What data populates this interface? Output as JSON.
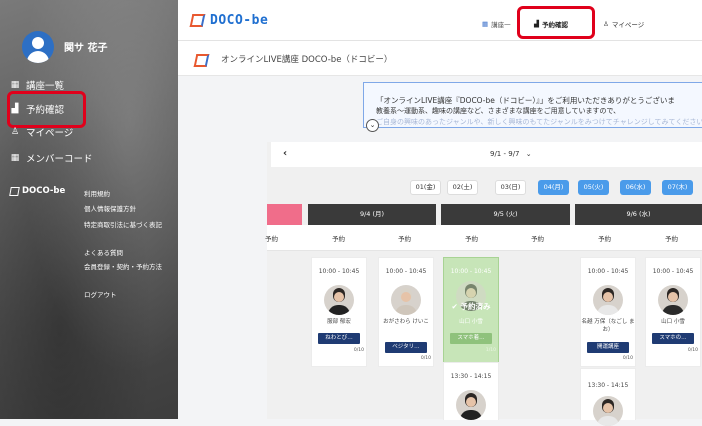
{
  "user": {
    "name": "関サ 花子"
  },
  "sidebar": {
    "items": [
      {
        "label": "講座一覧",
        "icon": "calendar-icon"
      },
      {
        "label": "予約確認",
        "icon": "booking-icon"
      },
      {
        "label": "マイページ",
        "icon": "person-icon"
      },
      {
        "label": "メンバーコード",
        "icon": "grid-icon"
      }
    ],
    "brand": "DOCO-be",
    "footer_links": [
      "利用規約",
      "個人情報保護方針",
      "特定商取引法に基づく表記",
      "よくある質問",
      "会員登録・契約・予約方法",
      "ログアウト"
    ]
  },
  "header": {
    "brand": "DOCO-be",
    "nav": [
      {
        "label": "講座一",
        "icon": "calendar-icon"
      },
      {
        "label": "予約確認",
        "icon": "booking-icon"
      },
      {
        "label": "マイページ",
        "icon": "person-icon"
      }
    ]
  },
  "subheader": {
    "title": "オンラインLIVE講座 DOCO-be（ドコビー）"
  },
  "notice": {
    "line1": "「オンラインLIVE講座『DOCO-be（ドコビー）』」をご利用いただきありがとうございま",
    "line2": "教養系～運動系、趣味の講座など、さまざまな講座をご用意していますので、",
    "line3": "ご自身の興味のあったジャンルや、新しく興味のもてたジャンルをみつけてチャレンジしてみてください。"
  },
  "schedule": {
    "prev_icon": "‹",
    "range": "9/1 - 9/7",
    "range_icon": "⌄",
    "date_pills": [
      {
        "label": "01(金)",
        "style": "white"
      },
      {
        "label": "02(土)",
        "style": "white"
      },
      {
        "label": "03(日)",
        "style": "white"
      },
      {
        "label": "04(月)",
        "style": "blue"
      },
      {
        "label": "05(火)",
        "style": "blue"
      },
      {
        "label": "06(水)",
        "style": "blue"
      },
      {
        "label": "07(木)",
        "style": "blue"
      }
    ],
    "columns": [
      "9/4 (月)",
      "9/5 (火)",
      "9/6 (水)"
    ],
    "yoyaku": "予約",
    "cards": [
      {
        "time": "10:00 - 10:45",
        "name": "服部 郁宏",
        "button": "ねわとび…",
        "cap": "0/10"
      },
      {
        "time": "10:00 - 10:45",
        "name": "おがさわら けいこ",
        "button": "ベジタリ…",
        "cap": "0/10"
      },
      {
        "time": "10:00 - 10:45",
        "name": "山口 小雪",
        "button": "スマホ着…",
        "cap": "1/10",
        "reserved": "✔ 予約済み"
      },
      {
        "time": "10:00 - 10:45",
        "name": "名越 万保（なごし まお）",
        "button": "開運講座",
        "cap": "0/10"
      },
      {
        "time": "10:00 - 10:45",
        "name": "山口 小雪",
        "button": "スマホの…",
        "cap": "0/10"
      },
      {
        "time": "13:30 - 14:15",
        "name": "",
        "button": "",
        "cap": ""
      },
      {
        "time": "13:30 - 14:15",
        "name": "",
        "button": "",
        "cap": ""
      }
    ]
  }
}
